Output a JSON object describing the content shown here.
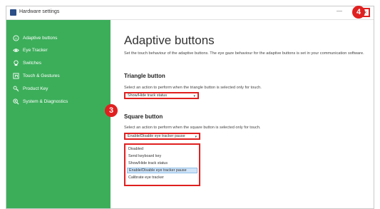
{
  "window": {
    "title": "Hardware settings",
    "minimize_glyph": "—",
    "close_glyph": "×"
  },
  "sidebar": {
    "items": [
      {
        "label": "Adaptive buttons",
        "icon": "circle-a-icon"
      },
      {
        "label": "Eye Tracker",
        "icon": "eye-icon"
      },
      {
        "label": "Switches",
        "icon": "switch-icon"
      },
      {
        "label": "Touch & Gestures",
        "icon": "hand-icon"
      },
      {
        "label": "Product Key",
        "icon": "key-icon"
      },
      {
        "label": "System & Diagnostics",
        "icon": "diagnostics-icon"
      }
    ]
  },
  "main": {
    "title": "Adaptive buttons",
    "description": "Set the touch behaviour of the adaptive buttons. The eye gaze behaviour for the adaptive buttons is set in your communication software.",
    "triangle": {
      "heading": "Triangle button",
      "instruction": "Select an action to perform when the triangle button is selected only for touch.",
      "selected": "Show/Hide track status"
    },
    "square": {
      "heading": "Square button",
      "instruction": "Select an action to perform when the square button is selected only for touch.",
      "selected": "Enable/Disable eye tracker pause",
      "options": [
        "Disabled",
        "Send keyboard key",
        "Show/Hide track status",
        "Enable/Disable eye tracker pause",
        "Calibrate eye tracker"
      ],
      "highlighted_index": 3
    }
  },
  "callouts": {
    "step3": "3",
    "step4": "4"
  },
  "colors": {
    "sidebar": "#3cae5a",
    "callout": "#e02020",
    "highlight": "#cfe3f7"
  }
}
